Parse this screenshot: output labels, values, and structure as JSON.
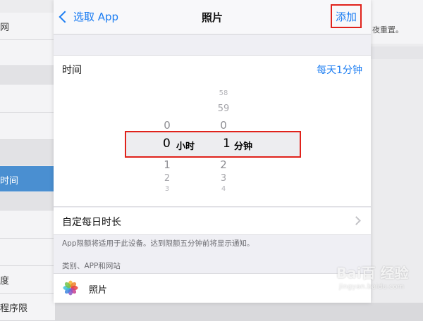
{
  "background": {
    "sidebar_items": [
      "网",
      "时间",
      "度",
      "程序限"
    ],
    "right_note": "夜重置。"
  },
  "nav": {
    "back_label": "选取 App",
    "title": "照片",
    "add_label": "添加"
  },
  "time_row": {
    "label": "时间",
    "value": "每天1分钟"
  },
  "picker": {
    "hours_above": [
      "0"
    ],
    "hours_below": [
      "1",
      "2",
      "3"
    ],
    "minutes_above": [
      "58",
      "59",
      "0"
    ],
    "minutes_below": [
      "2",
      "3",
      "4"
    ],
    "selected_hours": "0",
    "hours_unit": "小时",
    "selected_minutes": "1",
    "minutes_unit": "分钟"
  },
  "custom_row": {
    "label": "自定每日时长"
  },
  "footnote": "App限额将适用于此设备。达到限额五分钟前将显示通知。",
  "section_header": "类别、APP和网站",
  "app_row": {
    "icon": "photos-icon",
    "label": "照片"
  },
  "watermark": {
    "brand": "Bai百 经验",
    "site": "jingyan.baidu.com"
  },
  "colors": {
    "accent": "#1a7cf2",
    "highlight_border": "#e0221b",
    "selected_sidebar": "#4a8fd1"
  }
}
